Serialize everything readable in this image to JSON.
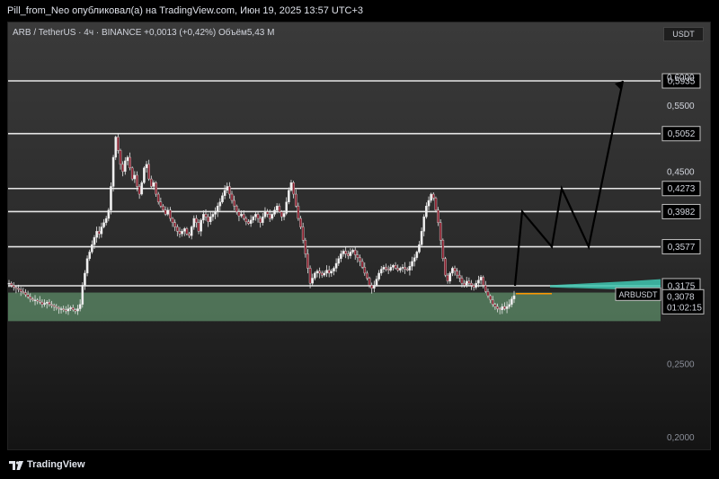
{
  "header": {
    "publisher_line": "Pill_from_Neo опубликовал(а) на TradingView.com, Июн 19, 2025 13:57 UTC+3"
  },
  "legend": {
    "text": "ARB / TetherUS · 4ч · BINANCE  +0,0013 (+0,42%)  Объём5,43 M"
  },
  "currency": "USDT",
  "footer": {
    "brand": "TradingView"
  },
  "chart_data": {
    "type": "candlestick",
    "symbol": "ARBUSDT",
    "exchange": "BINANCE",
    "interval": "4ч",
    "change": "+0,0013 (+0,42%)",
    "volume": "5,43 M",
    "y_scale": "log",
    "ylim": [
      0.155,
      0.615
    ],
    "y_ticks": [
      "0,6000",
      "0,5500",
      "0,4500",
      "0,2500",
      "0,2000"
    ],
    "horizontal_levels": [
      {
        "label": "0,5935",
        "value": 0.5935
      },
      {
        "label": "0,5052",
        "value": 0.5052
      },
      {
        "label": "0,4273",
        "value": 0.4273
      },
      {
        "label": "0,3982",
        "value": 0.3982
      },
      {
        "label": "0,3577",
        "value": 0.3577
      },
      {
        "label": "0,3175",
        "value": 0.3175
      }
    ],
    "support_zone": [
      0.285,
      0.311
    ],
    "current_price": {
      "symbol_label": "ARBUSDT",
      "label": "0,3078",
      "value": 0.3078,
      "countdown": "01:02:15"
    },
    "close_path": [
      0.32,
      0.318,
      0.316,
      0.315,
      0.314,
      0.312,
      0.311,
      0.309,
      0.307,
      0.305,
      0.304,
      0.304,
      0.303,
      0.302,
      0.3,
      0.301,
      0.302,
      0.3,
      0.299,
      0.298,
      0.297,
      0.296,
      0.296,
      0.295,
      0.294,
      0.296,
      0.297,
      0.295,
      0.294,
      0.296,
      0.3,
      0.318,
      0.33,
      0.345,
      0.352,
      0.36,
      0.368,
      0.375,
      0.372,
      0.38,
      0.385,
      0.39,
      0.4,
      0.43,
      0.47,
      0.5,
      0.48,
      0.46,
      0.45,
      0.465,
      0.47,
      0.455,
      0.44,
      0.445,
      0.43,
      0.42,
      0.435,
      0.455,
      0.46,
      0.44,
      0.43,
      0.435,
      0.42,
      0.41,
      0.405,
      0.4,
      0.395,
      0.4,
      0.39,
      0.385,
      0.38,
      0.375,
      0.372,
      0.375,
      0.378,
      0.372,
      0.37,
      0.38,
      0.39,
      0.385,
      0.375,
      0.388,
      0.395,
      0.392,
      0.386,
      0.392,
      0.395,
      0.398,
      0.405,
      0.41,
      0.418,
      0.425,
      0.43,
      0.42,
      0.412,
      0.405,
      0.398,
      0.393,
      0.395,
      0.39,
      0.386,
      0.384,
      0.388,
      0.392,
      0.395,
      0.39,
      0.385,
      0.392,
      0.398,
      0.395,
      0.39,
      0.395,
      0.4,
      0.405,
      0.398,
      0.392,
      0.396,
      0.41,
      0.425,
      0.435,
      0.42,
      0.405,
      0.39,
      0.38,
      0.365,
      0.35,
      0.335,
      0.32,
      0.325,
      0.33,
      0.332,
      0.33,
      0.328,
      0.33,
      0.333,
      0.33,
      0.332,
      0.335,
      0.34,
      0.345,
      0.35,
      0.353,
      0.35,
      0.348,
      0.352,
      0.354,
      0.349,
      0.346,
      0.342,
      0.336,
      0.33,
      0.325,
      0.318,
      0.315,
      0.318,
      0.324,
      0.33,
      0.334,
      0.336,
      0.334,
      0.333,
      0.336,
      0.338,
      0.335,
      0.333,
      0.335,
      0.336,
      0.334,
      0.333,
      0.337,
      0.342,
      0.346,
      0.352,
      0.36,
      0.375,
      0.392,
      0.405,
      0.412,
      0.42,
      0.415,
      0.4,
      0.385,
      0.365,
      0.345,
      0.328,
      0.322,
      0.33,
      0.335,
      0.332,
      0.328,
      0.325,
      0.32,
      0.318,
      0.322,
      0.32,
      0.318,
      0.316,
      0.32,
      0.323,
      0.326,
      0.318,
      0.312,
      0.308,
      0.304,
      0.3,
      0.298,
      0.296,
      0.295,
      0.298,
      0.296,
      0.298,
      0.3,
      0.305,
      0.308
    ],
    "projection": [
      0.3175,
      0.3982,
      0.3577,
      0.4273,
      0.3577,
      0.5935
    ]
  }
}
